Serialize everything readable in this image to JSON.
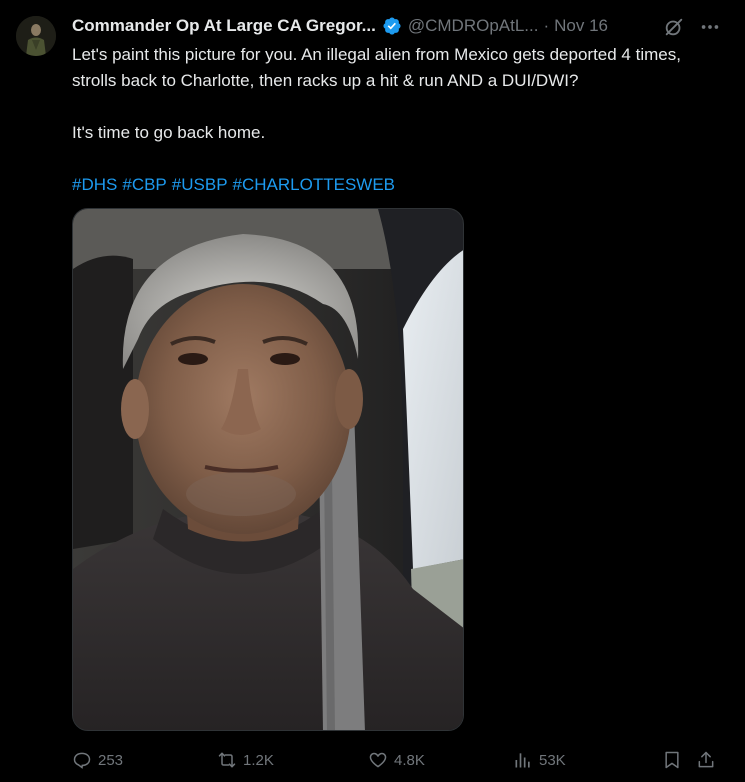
{
  "tweet": {
    "display_name": "Commander Op At Large CA Gregor...",
    "handle": "@CMDROpAtL...",
    "separator": "·",
    "date": "Nov 16",
    "text_line1": "Let's paint this picture for you. An illegal alien from Mexico gets deported 4 times, strolls back to Charlotte, then racks up a hit & run AND a DUI/DWI?",
    "text_line2": "It's time to go back home.",
    "hashtags": [
      "#DHS",
      "#CBP",
      "#USBP",
      "#CHARLOTTESWEB"
    ]
  },
  "actions": {
    "replies": "253",
    "reposts": "1.2K",
    "likes": "4.8K",
    "views": "53K"
  },
  "colors": {
    "background": "#000000",
    "text": "#e7e9ea",
    "muted": "#71767b",
    "link": "#1d9bf0",
    "verified": "#1d9bf0"
  },
  "icons": [
    "verified-badge-icon",
    "grok-icon",
    "more-icon",
    "reply-icon",
    "repost-icon",
    "like-icon",
    "views-icon",
    "bookmark-icon",
    "share-icon"
  ]
}
